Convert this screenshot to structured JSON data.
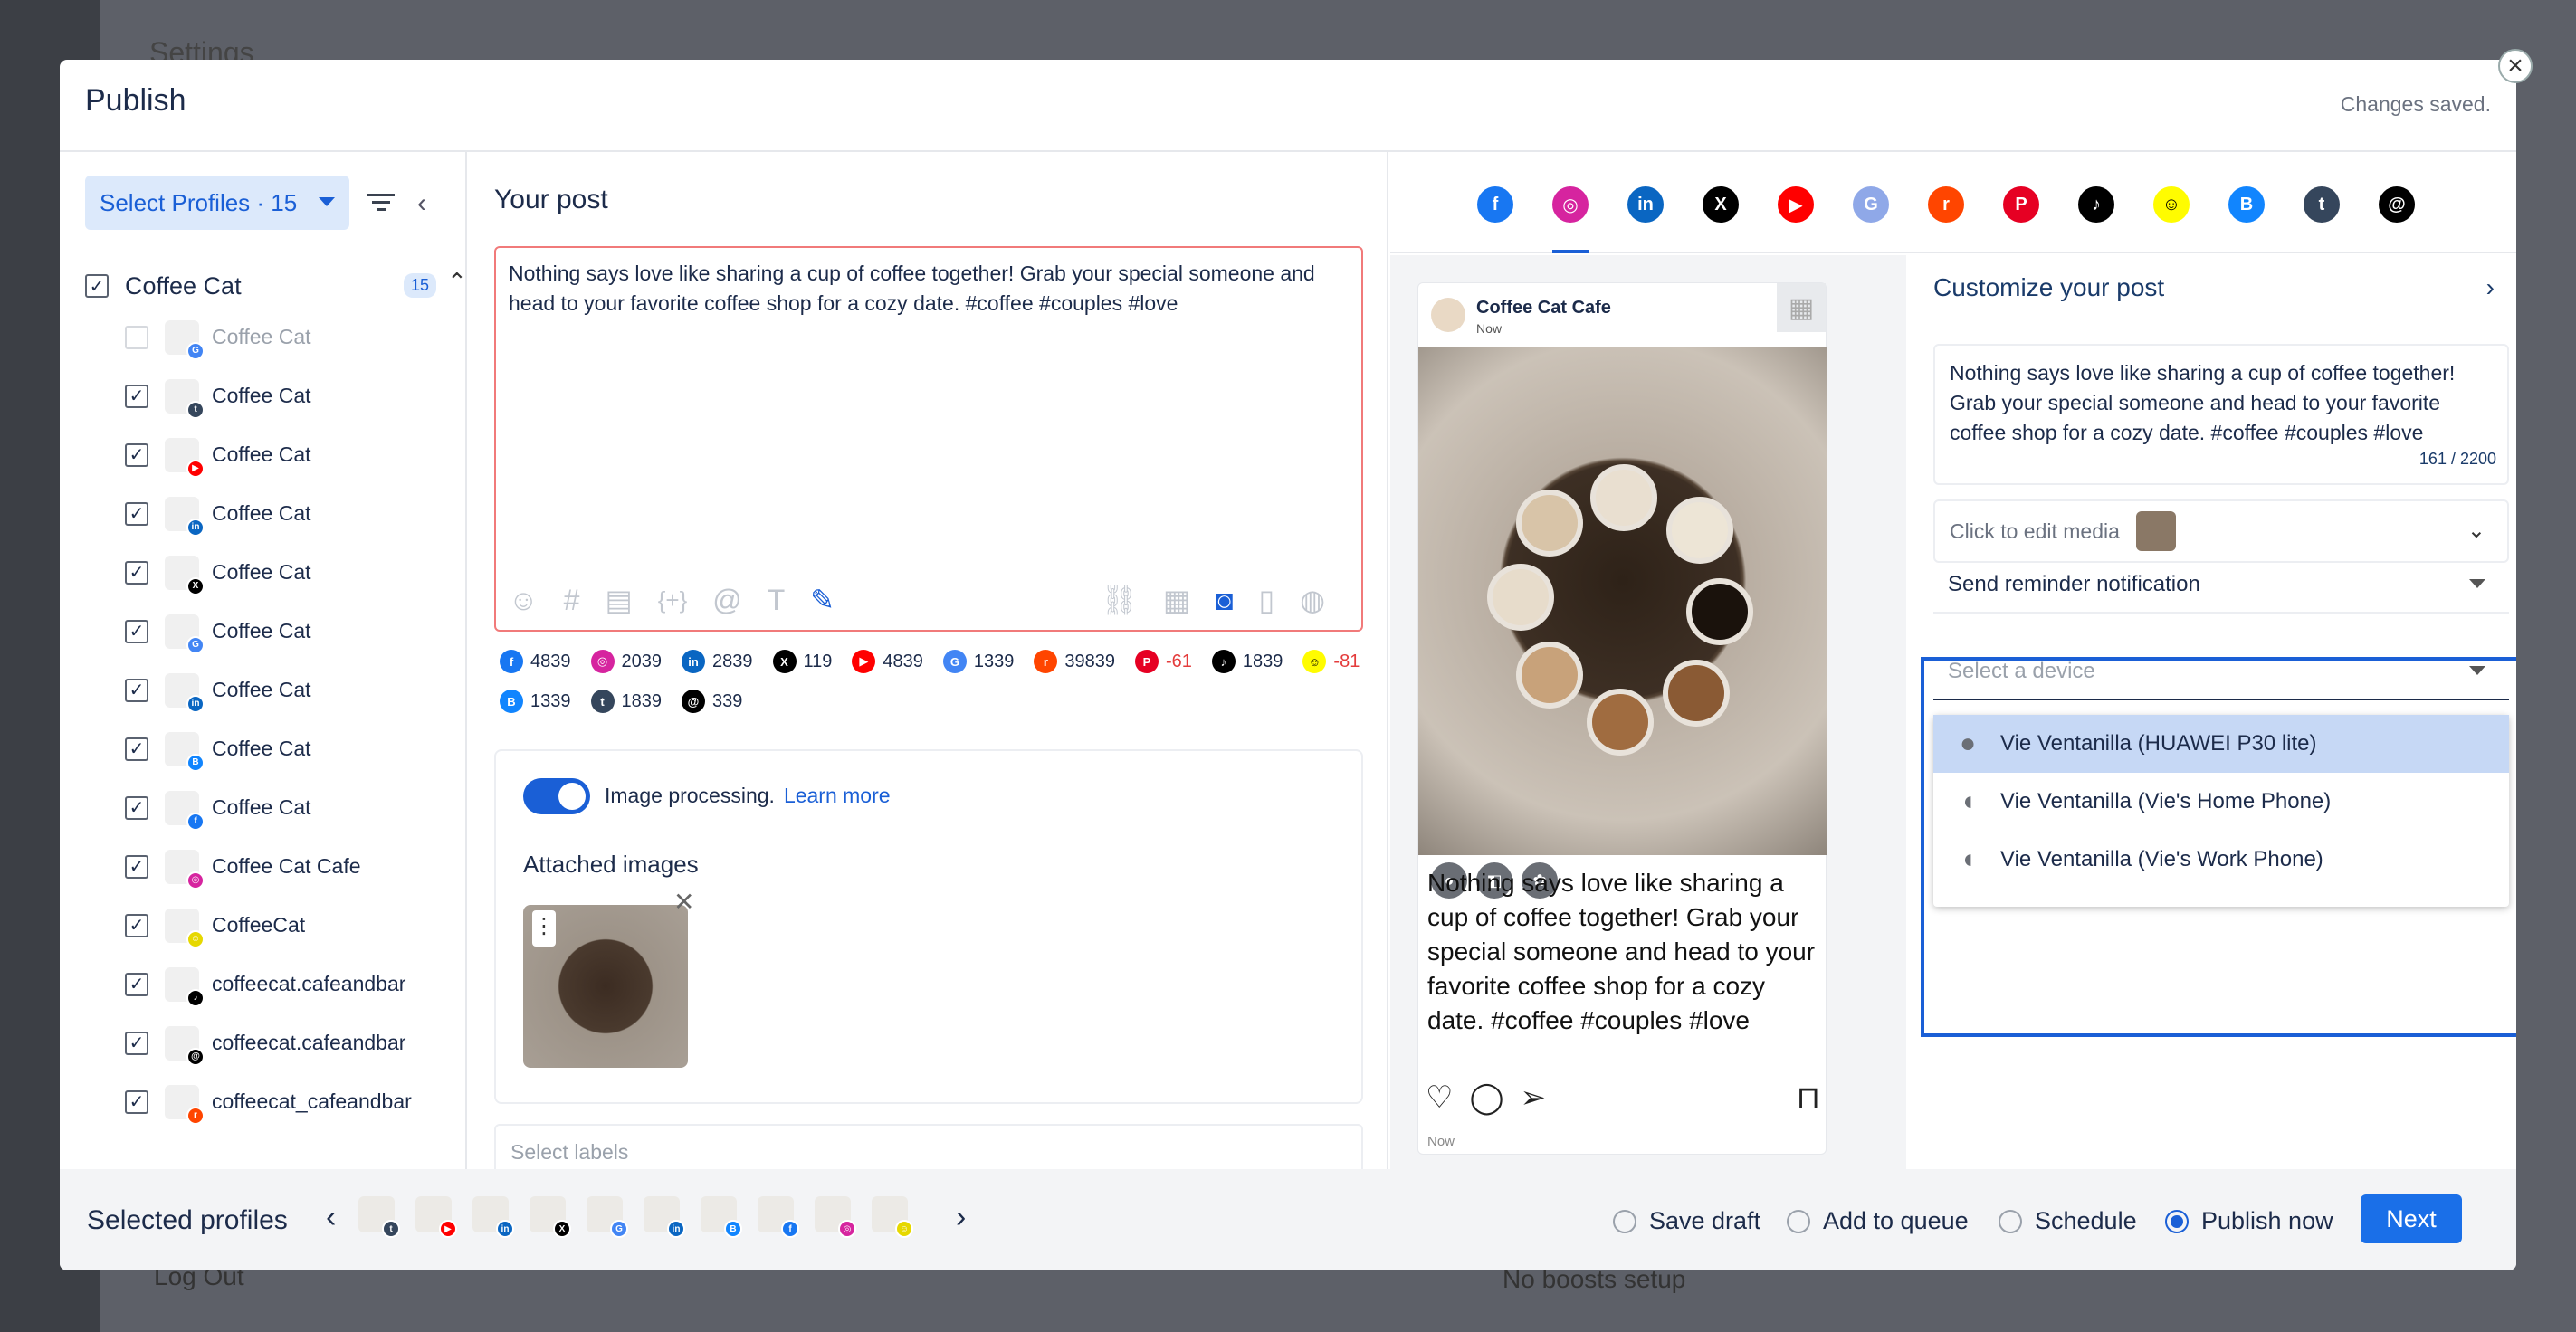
{
  "background": {
    "settings_title": "Settings",
    "logout": "Log Out",
    "no_boosts": "No boosts setup"
  },
  "modal": {
    "title": "Publish",
    "status": "Changes saved.",
    "close_icon": "close-icon"
  },
  "left": {
    "select_profiles_label": "Select Profiles · 15",
    "group": {
      "name": "Coffee Cat",
      "count": "15",
      "checked": true
    },
    "profiles": [
      {
        "name": "Coffee Cat",
        "network": "google-business",
        "checked": false,
        "dim": true
      },
      {
        "name": "Coffee Cat",
        "network": "tumblr",
        "checked": true
      },
      {
        "name": "Coffee Cat",
        "network": "youtube",
        "checked": true
      },
      {
        "name": "Coffee Cat",
        "network": "linkedin",
        "checked": true
      },
      {
        "name": "Coffee Cat",
        "network": "x",
        "checked": true
      },
      {
        "name": "Coffee Cat",
        "network": "google-business",
        "checked": true
      },
      {
        "name": "Coffee Cat",
        "network": "linkedin-page",
        "checked": true
      },
      {
        "name": "Coffee Cat",
        "network": "bluesky",
        "checked": true
      },
      {
        "name": "Coffee Cat",
        "network": "facebook",
        "checked": true
      },
      {
        "name": "Coffee Cat Cafe",
        "network": "instagram",
        "checked": true
      },
      {
        "name": "CoffeeCat",
        "network": "snapchat",
        "checked": true
      },
      {
        "name": "coffeecat.cafeandbar",
        "network": "tiktok",
        "checked": true
      },
      {
        "name": "coffeecat.cafeandbar",
        "network": "threads",
        "checked": true
      },
      {
        "name": "coffeecat_cafeandbar",
        "network": "reddit",
        "checked": true
      }
    ]
  },
  "center": {
    "title": "Your post",
    "post_text": "Nothing says love like sharing a cup of coffee together! Grab your special someone and head to your favorite coffee shop for a cozy date. #coffee #couples #love",
    "counts": [
      {
        "network": "facebook",
        "value": "4839",
        "color": "#1877f2",
        "glyph": "f"
      },
      {
        "network": "instagram",
        "value": "2039",
        "color": "#d6249f",
        "glyph": "◎"
      },
      {
        "network": "linkedin",
        "value": "2839",
        "color": "#0a66c2",
        "glyph": "in"
      },
      {
        "network": "x",
        "value": "119",
        "color": "#000000",
        "glyph": "X"
      },
      {
        "network": "youtube",
        "value": "4839",
        "color": "#ff0000",
        "glyph": "▶"
      },
      {
        "network": "google-business",
        "value": "1339",
        "color": "#4285f4",
        "glyph": "G"
      },
      {
        "network": "reddit",
        "value": "39839",
        "color": "#ff4500",
        "glyph": "r"
      },
      {
        "network": "pinterest",
        "value": "-61",
        "color": "#e60023",
        "glyph": "P",
        "negative": true
      },
      {
        "network": "tiktok",
        "value": "1839",
        "color": "#000000",
        "glyph": "♪"
      },
      {
        "network": "snapchat",
        "value": "-81",
        "color": "#fffc00",
        "glyph": "☺",
        "negative": true
      },
      {
        "network": "bluesky",
        "value": "1339",
        "color": "#1185fe",
        "glyph": "B"
      },
      {
        "network": "tumblr",
        "value": "1839",
        "color": "#35465c",
        "glyph": "t"
      },
      {
        "network": "threads",
        "value": "339",
        "color": "#000000",
        "glyph": "@"
      }
    ],
    "image_processing": "Image processing.",
    "learn_more": "Learn more",
    "attached_images": "Attached images",
    "labels_placeholder": "Select labels"
  },
  "preview": {
    "account": "Coffee Cat Cafe",
    "time": "Now",
    "caption": "Nothing says love like sharing a cup of coffee together! Grab your special someone and head to your favorite coffee shop for a cozy date. #coffee #couples #love",
    "footer_time": "Now"
  },
  "customize": {
    "title": "Customize your post",
    "text": "Nothing says love like sharing a cup of coffee together! Grab your special someone and head to your favorite coffee shop for a cozy date. #coffee #couples #love",
    "char_count": "161 / 2200",
    "media_label": "Click to edit media",
    "reminder": "Send reminder notification",
    "device_placeholder": "Select a device",
    "devices": [
      {
        "label": "Vie Ventanilla (HUAWEI P30 lite)",
        "icon": "person-icon",
        "selected": true
      },
      {
        "label": "Vie Ventanilla (Vie's Home Phone)",
        "icon": "apple-icon",
        "selected": false
      },
      {
        "label": "Vie Ventanilla (Vie's Work Phone)",
        "icon": "apple-icon",
        "selected": false
      }
    ]
  },
  "network_tabs": [
    {
      "name": "facebook",
      "color": "#1877f2",
      "glyph": "f"
    },
    {
      "name": "instagram",
      "color": "#d6249f",
      "glyph": "◎",
      "active": true
    },
    {
      "name": "linkedin",
      "color": "#0a66c2",
      "glyph": "in"
    },
    {
      "name": "x",
      "color": "#000000",
      "glyph": "X"
    },
    {
      "name": "youtube",
      "color": "#ff0000",
      "glyph": "▶"
    },
    {
      "name": "google-business",
      "color": "#8fa8e8",
      "glyph": "G"
    },
    {
      "name": "reddit",
      "color": "#ff4500",
      "glyph": "r"
    },
    {
      "name": "pinterest",
      "color": "#e60023",
      "glyph": "P"
    },
    {
      "name": "tiktok",
      "color": "#000000",
      "glyph": "♪"
    },
    {
      "name": "snapchat",
      "color": "#fffc00",
      "glyph": "☺"
    },
    {
      "name": "bluesky",
      "color": "#1185fe",
      "glyph": "B"
    },
    {
      "name": "tumblr",
      "color": "#35465c",
      "glyph": "t"
    },
    {
      "name": "threads",
      "color": "#000000",
      "glyph": "@"
    }
  ],
  "footer": {
    "selected_label": "Selected profiles",
    "options": [
      {
        "label": "Save draft",
        "selected": false
      },
      {
        "label": "Add to queue",
        "selected": false
      },
      {
        "label": "Schedule",
        "selected": false
      },
      {
        "label": "Publish now",
        "selected": true
      }
    ],
    "next": "Next"
  }
}
